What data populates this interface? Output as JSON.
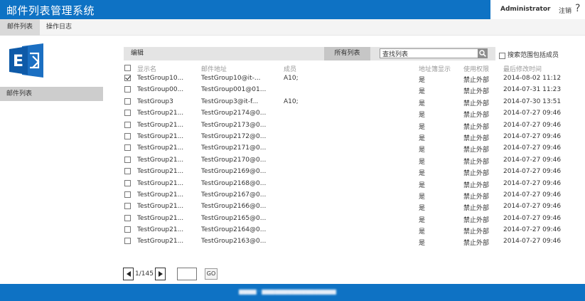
{
  "header": {
    "title": "邮件列表管理系统",
    "user": "Administrator",
    "logout_label": "注销",
    "help_label": "?"
  },
  "tabs": [
    {
      "label": "邮件列表",
      "active": true
    },
    {
      "label": "操作日志",
      "active": false
    }
  ],
  "sidebar": {
    "logo_icon": "exchange-logo-icon",
    "items": [
      {
        "label": "邮件列表",
        "selected": true
      }
    ]
  },
  "toolbar": {
    "edit_label": "编辑",
    "all_lists_label": "所有列表",
    "search_value": "查找列表",
    "search_icon": "search-icon",
    "scope_label": "搜索范围包括成员",
    "scope_checked": false
  },
  "table": {
    "columns": [
      "显示名",
      "邮件地址",
      "成员",
      "地址簿显示",
      "使用权限",
      "最后修改时间"
    ],
    "rows": [
      {
        "checked": true,
        "display_name": "TestGroup10...",
        "email": "TestGroup10@it-...",
        "members": "A10;",
        "visible": "是",
        "permission": "禁止外部",
        "modified": "2014-08-02 11:12"
      },
      {
        "checked": false,
        "display_name": "TestGroup00...",
        "email": "TestGroup001@01...",
        "members": "",
        "visible": "是",
        "permission": "禁止外部",
        "modified": "2014-07-31 11:23"
      },
      {
        "checked": false,
        "display_name": "TestGroup3",
        "email": "TestGroup3@it-f...",
        "members": "A10;",
        "visible": "是",
        "permission": "禁止外部",
        "modified": "2014-07-30 13:51"
      },
      {
        "checked": false,
        "display_name": "TestGroup21...",
        "email": "TestGroup2174@0...",
        "members": "",
        "visible": "是",
        "permission": "禁止外部",
        "modified": "2014-07-27 09:46"
      },
      {
        "checked": false,
        "display_name": "TestGroup21...",
        "email": "TestGroup2173@0...",
        "members": "",
        "visible": "是",
        "permission": "禁止外部",
        "modified": "2014-07-27 09:46"
      },
      {
        "checked": false,
        "display_name": "TestGroup21...",
        "email": "TestGroup2172@0...",
        "members": "",
        "visible": "是",
        "permission": "禁止外部",
        "modified": "2014-07-27 09:46"
      },
      {
        "checked": false,
        "display_name": "TestGroup21...",
        "email": "TestGroup2171@0...",
        "members": "",
        "visible": "是",
        "permission": "禁止外部",
        "modified": "2014-07-27 09:46"
      },
      {
        "checked": false,
        "display_name": "TestGroup21...",
        "email": "TestGroup2170@0...",
        "members": "",
        "visible": "是",
        "permission": "禁止外部",
        "modified": "2014-07-27 09:46"
      },
      {
        "checked": false,
        "display_name": "TestGroup21...",
        "email": "TestGroup2169@0...",
        "members": "",
        "visible": "是",
        "permission": "禁止外部",
        "modified": "2014-07-27 09:46"
      },
      {
        "checked": false,
        "display_name": "TestGroup21...",
        "email": "TestGroup2168@0...",
        "members": "",
        "visible": "是",
        "permission": "禁止外部",
        "modified": "2014-07-27 09:46"
      },
      {
        "checked": false,
        "display_name": "TestGroup21...",
        "email": "TestGroup2167@0...",
        "members": "",
        "visible": "是",
        "permission": "禁止外部",
        "modified": "2014-07-27 09:46"
      },
      {
        "checked": false,
        "display_name": "TestGroup21...",
        "email": "TestGroup2166@0...",
        "members": "",
        "visible": "是",
        "permission": "禁止外部",
        "modified": "2014-07-27 09:46"
      },
      {
        "checked": false,
        "display_name": "TestGroup21...",
        "email": "TestGroup2165@0...",
        "members": "",
        "visible": "是",
        "permission": "禁止外部",
        "modified": "2014-07-27 09:46"
      },
      {
        "checked": false,
        "display_name": "TestGroup21...",
        "email": "TestGroup2164@0...",
        "members": "",
        "visible": "是",
        "permission": "禁止外部",
        "modified": "2014-07-27 09:46"
      },
      {
        "checked": false,
        "display_name": "TestGroup21...",
        "email": "TestGroup2163@0...",
        "members": "",
        "visible": "是",
        "permission": "禁止外部",
        "modified": "2014-07-27 09:46"
      }
    ]
  },
  "pager": {
    "page_text": "1/145",
    "page_input_value": "",
    "go_label": "GO"
  },
  "colors": {
    "brand_blue": "#0e72c4",
    "toolbar_gray": "#e4e4e4",
    "selected_gray": "#cdcdcd"
  }
}
